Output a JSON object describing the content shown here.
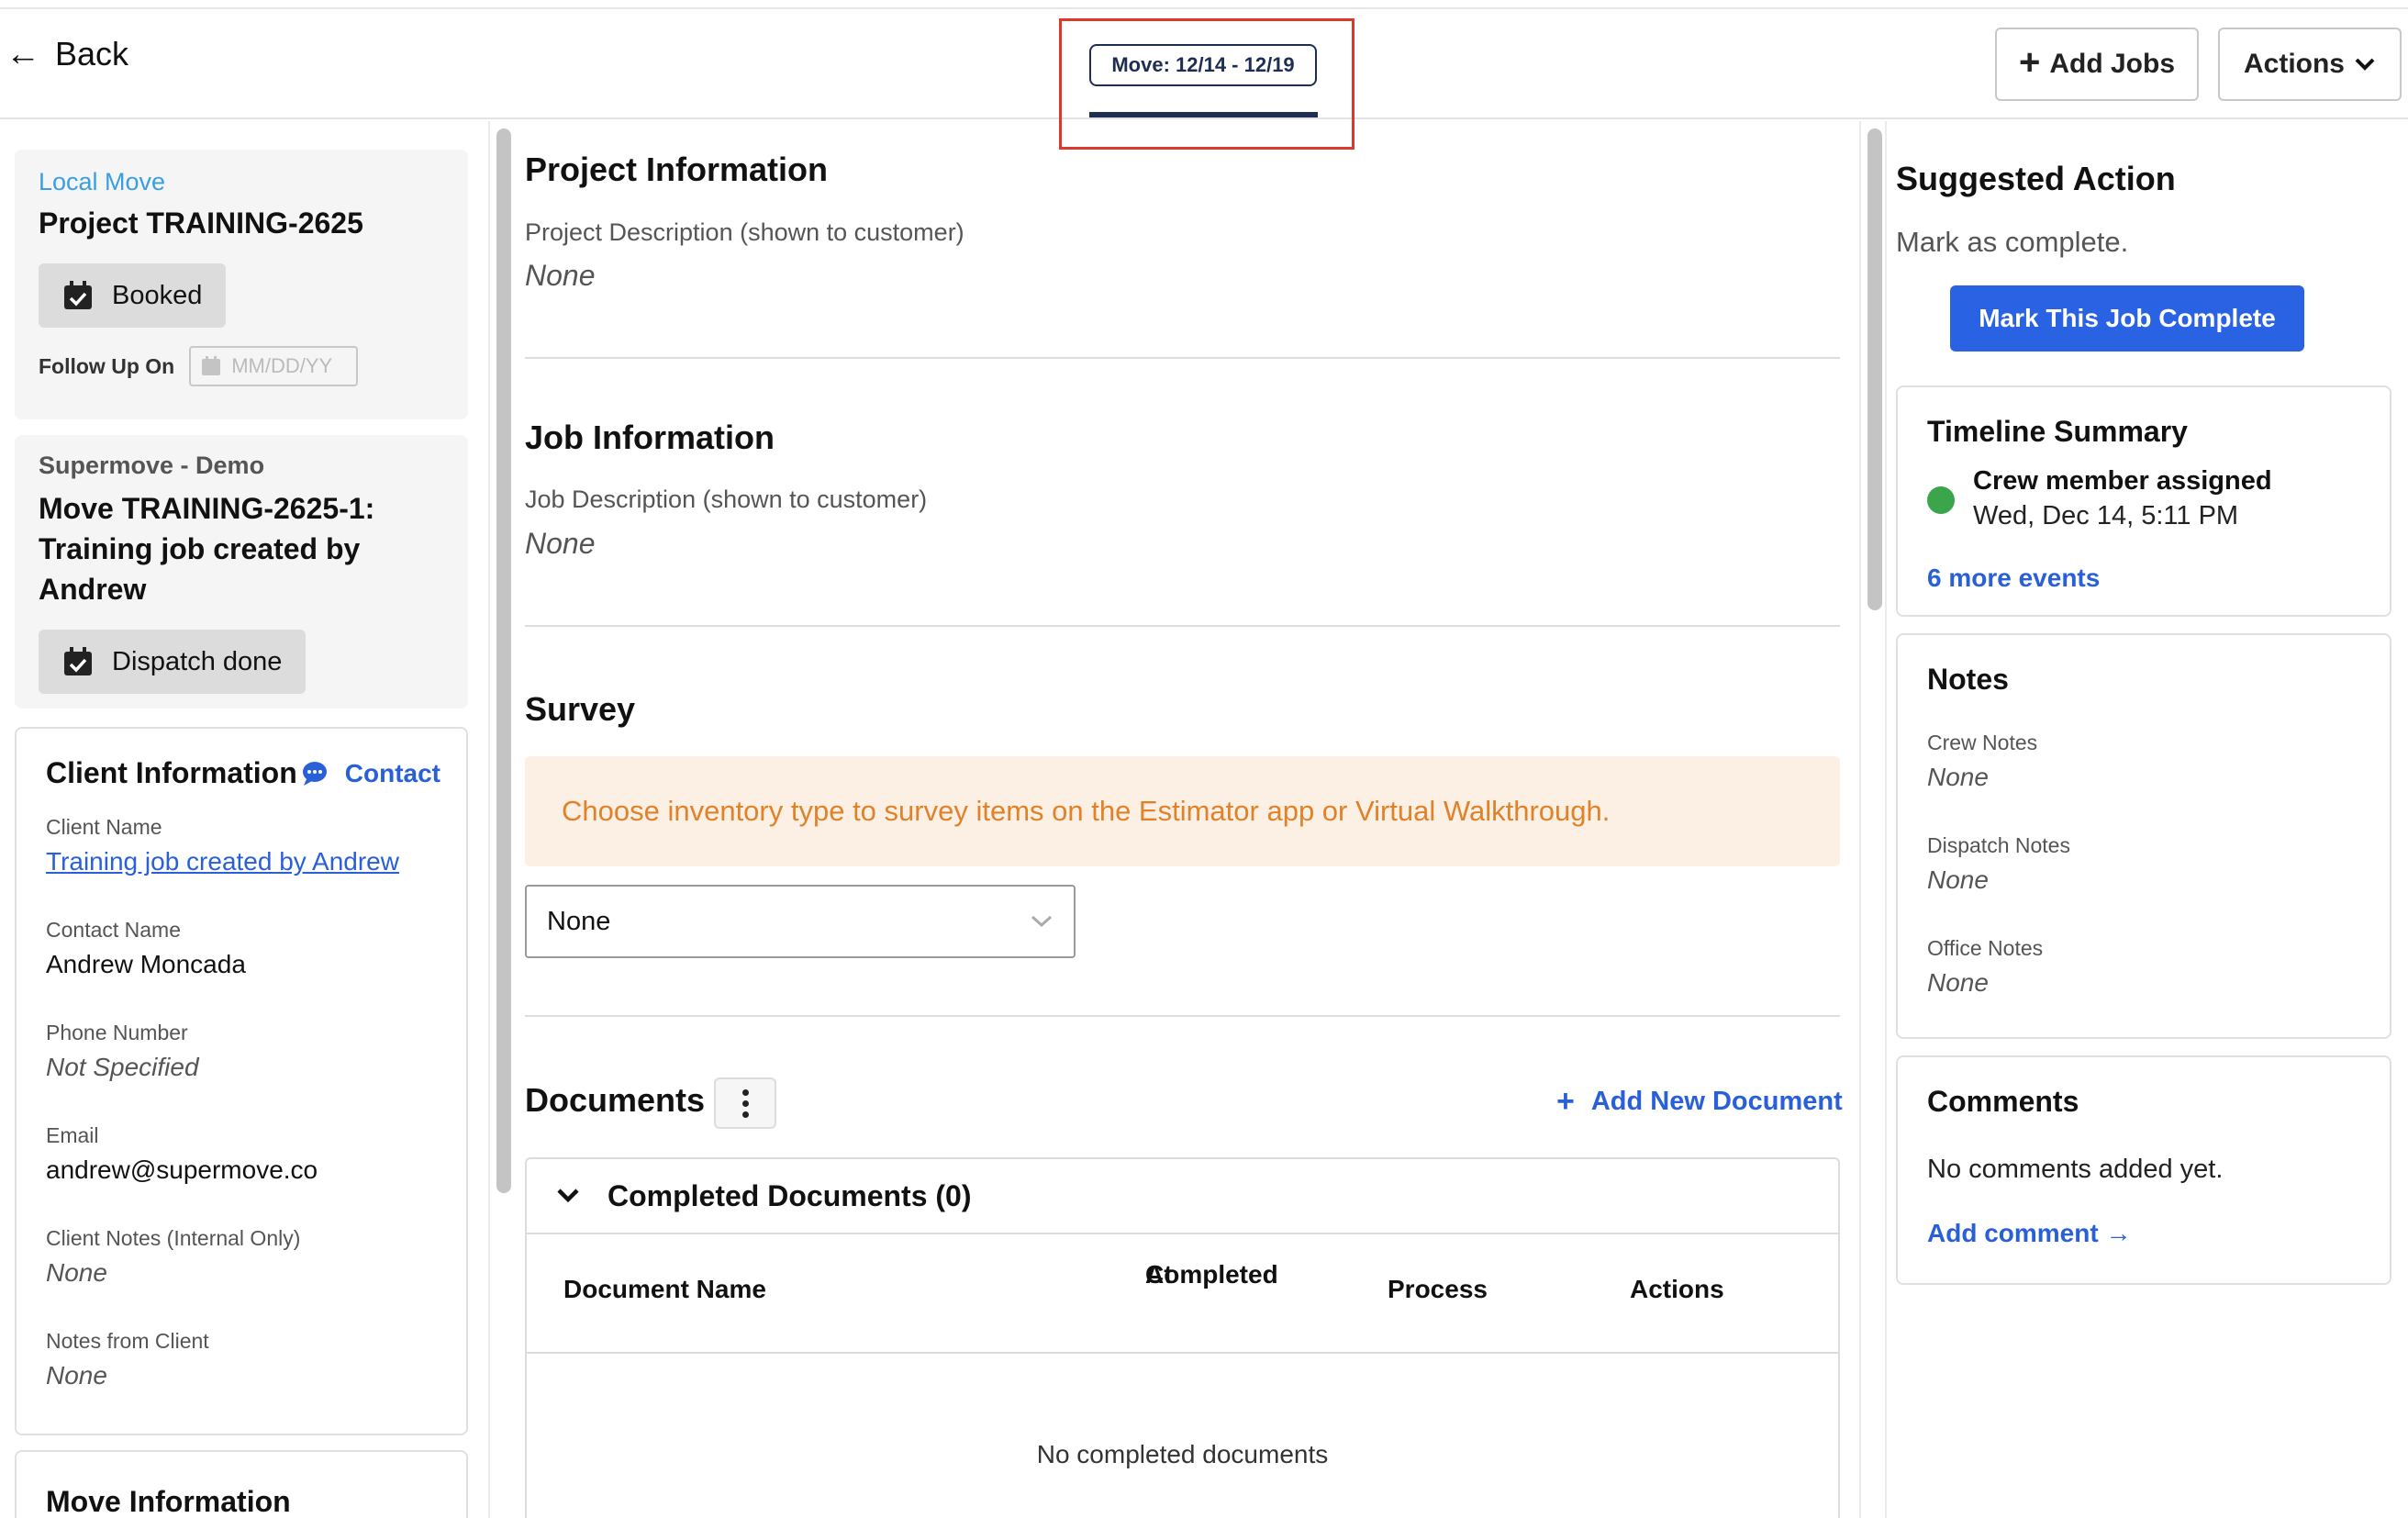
{
  "header": {
    "back_label": "Back",
    "move_tab": "Move: 12/14 - 12/19",
    "add_jobs_label": "Add Jobs",
    "actions_label": "Actions"
  },
  "project_card": {
    "type": "Local Move",
    "title": "Project TRAINING-2625",
    "status": "Booked",
    "follow_up_label": "Follow Up On",
    "follow_up_placeholder": "MM/DD/YY"
  },
  "job_card": {
    "org": "Supermove - Demo",
    "title_line1": "Move TRAINING-2625-1:",
    "title_line2": "Training job created by",
    "title_line3": "Andrew",
    "status": "Dispatch done"
  },
  "client_info": {
    "title": "Client Information",
    "contact_label": "Contact",
    "client_name_label": "Client Name",
    "client_name": "Training job created by Andrew",
    "contact_name_label": "Contact Name",
    "contact_name": "Andrew Moncada",
    "phone_label": "Phone Number",
    "phone": "Not Specified",
    "email_label": "Email",
    "email": "andrew@supermove.co",
    "client_notes_label": "Client Notes (Internal Only)",
    "client_notes": "None",
    "notes_from_client_label": "Notes from Client",
    "notes_from_client": "None"
  },
  "move_info": {
    "title": "Move Information"
  },
  "project_info": {
    "title": "Project Information",
    "desc_label": "Project Description (shown to customer)",
    "desc": "None"
  },
  "job_info": {
    "title": "Job Information",
    "desc_label": "Job Description (shown to customer)",
    "desc": "None"
  },
  "survey": {
    "title": "Survey",
    "banner": "Choose inventory type to survey items on the Estimator app or Virtual Walkthrough.",
    "select_value": "None"
  },
  "documents": {
    "title": "Documents",
    "add_label": "Add New Document",
    "completed_header": "Completed Documents (0)",
    "col_name": "Document Name",
    "col_completed_1": "Completed",
    "col_completed_2": "At",
    "col_process": "Process",
    "col_actions": "Actions",
    "empty": "No completed documents"
  },
  "suggested": {
    "title": "Suggested Action",
    "text": "Mark as complete.",
    "button": "Mark This Job Complete"
  },
  "timeline": {
    "title": "Timeline Summary",
    "event_title": "Crew member assigned",
    "event_time": "Wed, Dec 14, 5:11 PM",
    "more": "6 more events",
    "dot_color": "#3aa54a"
  },
  "notes": {
    "title": "Notes",
    "crew_label": "Crew Notes",
    "crew": "None",
    "dispatch_label": "Dispatch Notes",
    "dispatch": "None",
    "office_label": "Office Notes",
    "office": "None"
  },
  "comments": {
    "title": "Comments",
    "empty": "No comments added yet.",
    "add": "Add comment →"
  },
  "colors": {
    "primary": "#2962e3",
    "navy": "#1e2d52",
    "highlight": "#d93a2b",
    "banner_text": "#e0822a"
  }
}
